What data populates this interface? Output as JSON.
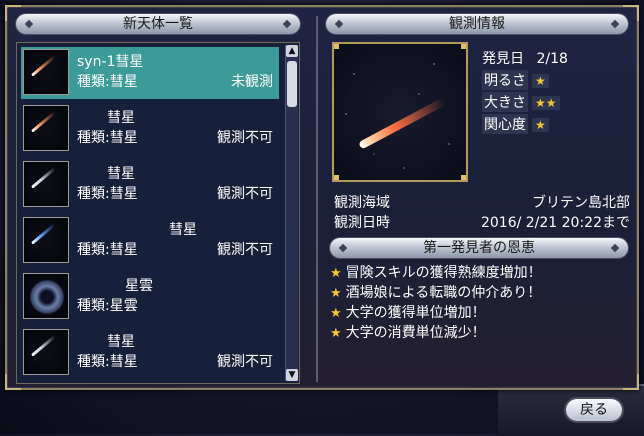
{
  "left_header": "新天体一覧",
  "right_header": "観測情報",
  "benefits_header": "第一発見者の恩恵",
  "list": [
    {
      "name": "syn-1彗星",
      "type": "種類:彗星",
      "status": "未観測",
      "icon": "red-comet-thumbnail",
      "selected": true
    },
    {
      "name": "彗星",
      "type": "種類:彗星",
      "status": "観測不可",
      "icon": "red-comet-thumbnail",
      "selected": false
    },
    {
      "name": "彗星",
      "type": "種類:彗星",
      "status": "観測不可",
      "icon": "white-comet-thumbnail",
      "selected": false
    },
    {
      "name": "彗星",
      "type": "種類:彗星",
      "status": "観測不可",
      "icon": "blue-comet-thumbnail",
      "selected": false
    },
    {
      "name": "星雲",
      "type": "種類:星雲",
      "status": "",
      "icon": "nebula-thumbnail",
      "selected": false
    },
    {
      "name": "彗星",
      "type": "種類:彗星",
      "status": "観測不可",
      "icon": "white-comet-thumbnail",
      "selected": false
    }
  ],
  "info": {
    "discovery_label": "発見日",
    "discovery_value": "2/18",
    "brightness_label": "明るさ",
    "brightness_stars": "★",
    "size_label": "大きさ",
    "size_stars": "★★",
    "interest_label": "関心度",
    "interest_stars": "★",
    "sea_label": "観測海域",
    "sea_value": "ブリテン島北部",
    "time_label": "観測日時",
    "time_value": "2016/ 2/21 20:22まで"
  },
  "benefits": [
    "冒険スキルの獲得熟練度増加！",
    "酒場娘による転職の仲介あり！",
    "大学の獲得単位増加！",
    "大学の消費単位減少！"
  ],
  "back_button": "戻る",
  "colors": {
    "selected_row": "#3c9a98",
    "star_gold": "#f6c631",
    "frame_gold": "#b49a5a"
  }
}
